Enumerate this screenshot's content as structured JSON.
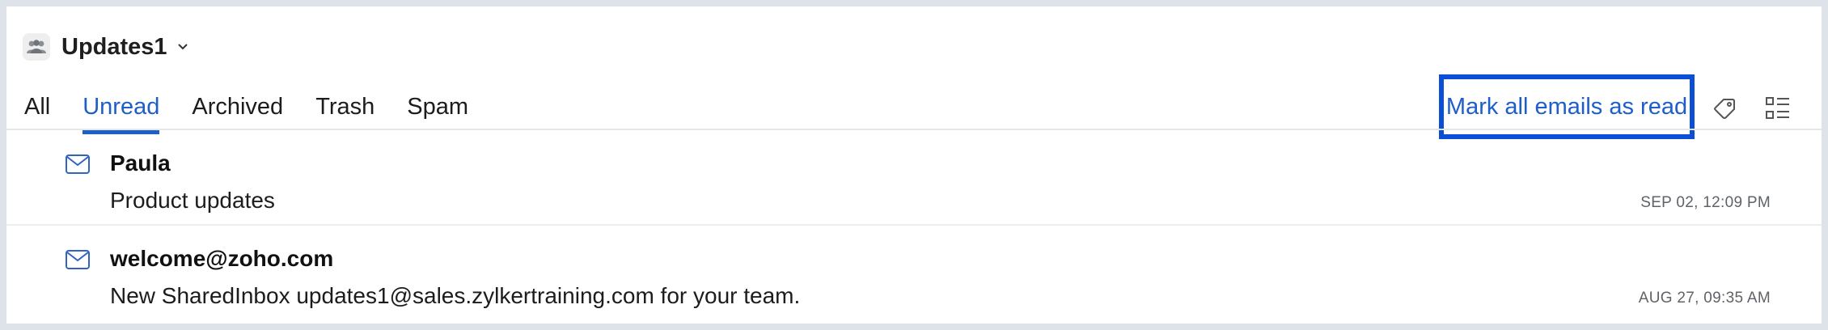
{
  "header": {
    "inbox_name": "Updates1",
    "avatar_icon": "group-icon",
    "dropdown_icon": "chevron-down-icon"
  },
  "tabs": [
    {
      "label": "All",
      "active": false
    },
    {
      "label": "Unread",
      "active": true
    },
    {
      "label": "Archived",
      "active": false
    },
    {
      "label": "Trash",
      "active": false
    },
    {
      "label": "Spam",
      "active": false
    }
  ],
  "toolbar": {
    "mark_all_label": "Mark all emails as read",
    "tag_icon": "tag-icon",
    "view_icon": "list-view-icon"
  },
  "emails": [
    {
      "sender": "Paula",
      "subject": "Product updates",
      "date": "SEP 02, 12:09 PM",
      "icon": "envelope-icon"
    },
    {
      "sender": "welcome@zoho.com",
      "subject": "New SharedInbox updates1@sales.zylkertraining.com for your team.",
      "date": "AUG 27, 09:35 AM",
      "icon": "envelope-icon"
    }
  ],
  "colors": {
    "accent": "#1d5ec8",
    "highlight_border": "#0a4fd6",
    "background": "#dde3e8"
  }
}
